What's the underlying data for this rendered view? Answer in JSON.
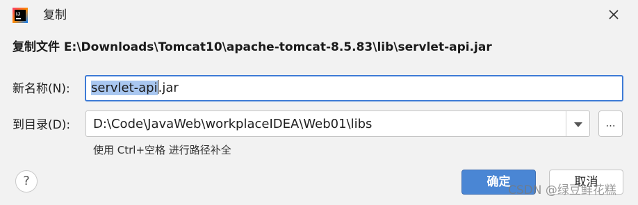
{
  "window": {
    "title": "复制",
    "app_icon": "intellij-idea-icon",
    "close_icon": "close-icon"
  },
  "heading": "复制文件 E:\\Downloads\\Tomcat10\\apache-tomcat-8.5.83\\lib\\servlet-api.jar",
  "new_name": {
    "label": "新名称(N):",
    "value_selected": "servlet-api",
    "value_rest": ".jar"
  },
  "target_dir": {
    "label": "到目录(D):",
    "value": "D:\\Code\\JavaWeb\\workplaceIDEA\\Web01\\libs",
    "dropdown_icon": "chevron-down-icon",
    "browse_label": "..."
  },
  "hint": "使用 Ctrl+空格 进行路径补全",
  "buttons": {
    "help_label": "?",
    "ok_label": "确定",
    "cancel_label": "取消"
  },
  "watermark": "CSDN @绿豆鲜花糕",
  "colors": {
    "accent": "#4a86d4",
    "focus_border": "#3d7bd6",
    "selection": "#a9c7f0"
  }
}
